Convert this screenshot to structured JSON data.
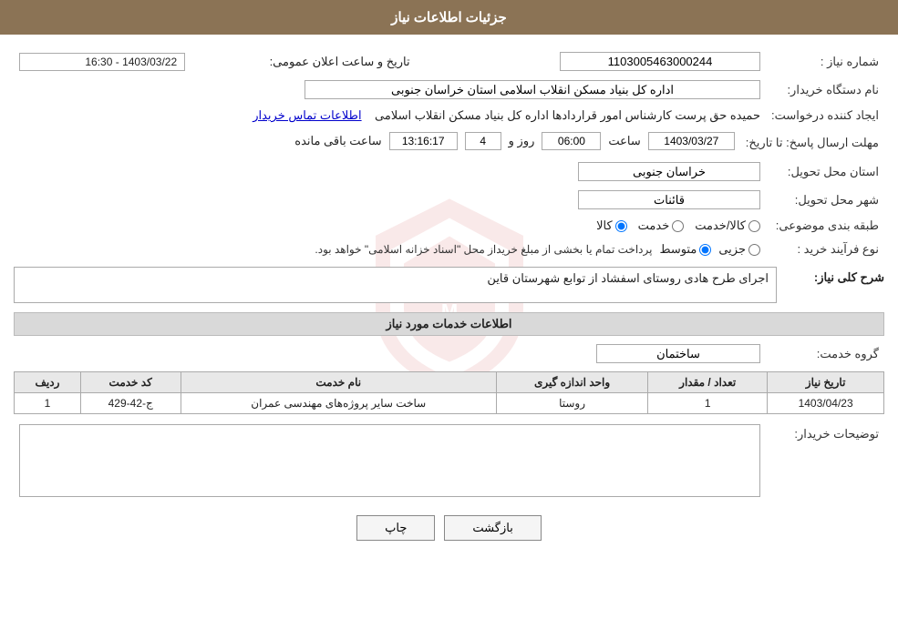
{
  "header": {
    "title": "جزئیات اطلاعات نیاز"
  },
  "fields": {
    "need_number_label": "شماره نیاز :",
    "need_number_value": "1103005463000244",
    "announcement_label": "تاریخ و ساعت اعلان عمومی:",
    "announcement_value": "1403/03/22 - 16:30",
    "buyer_label": "نام دستگاه خریدار:",
    "buyer_value": "اداره کل بنیاد مسکن انقلاب اسلامی استان خراسان جنوبی",
    "creator_label": "ایجاد کننده درخواست:",
    "creator_value": "حمیده حق پرست کارشناس امور قراردادها اداره کل بنیاد مسکن انقلاب اسلامی",
    "contact_link": "اطلاعات تماس خریدار",
    "deadline_label": "مهلت ارسال پاسخ: تا تاریخ:",
    "deadline_date": "1403/03/27",
    "deadline_time_label": "ساعت",
    "deadline_time": "06:00",
    "deadline_day_label": "روز و",
    "deadline_days": "4",
    "deadline_remaining_label": "ساعت باقی مانده",
    "deadline_remaining": "13:16:17",
    "province_label": "استان محل تحویل:",
    "province_value": "خراسان جنوبی",
    "city_label": "شهر محل تحویل:",
    "city_value": "قائنات",
    "category_label": "طبقه بندی موضوعی:",
    "category_goods": "کالا",
    "category_service": "خدمت",
    "category_goods_service": "کالا/خدمت",
    "purchase_label": "نوع فرآیند خرید :",
    "purchase_partial": "جزیی",
    "purchase_medium": "متوسط",
    "purchase_note": "پرداخت تمام یا بخشی از مبلغ خریداز محل \"اسناد خزانه اسلامی\" خواهد بود.",
    "description_section": "شرح کلی نیاز:",
    "description_value": "اجرای طرح هادی روستای اسفشاد از توابع شهرستان قاین",
    "services_section": "اطلاعات خدمات مورد نیاز",
    "service_group_label": "گروه خدمت:",
    "service_group_value": "ساختمان",
    "table_headers": {
      "row_num": "ردیف",
      "service_code": "کد خدمت",
      "service_name": "نام خدمت",
      "unit": "واحد اندازه گیری",
      "quantity": "تعداد / مقدار",
      "need_date": "تاریخ نیاز"
    },
    "table_rows": [
      {
        "row_num": "1",
        "service_code": "ج-42-429",
        "service_name": "ساخت سایر پروژه‌های مهندسی عمران",
        "unit": "روستا",
        "quantity": "1",
        "need_date": "1403/04/23"
      }
    ],
    "buyer_description_label": "توضیحات خریدار:",
    "buyer_description_value": "",
    "btn_print": "چاپ",
    "btn_back": "بازگشت"
  }
}
